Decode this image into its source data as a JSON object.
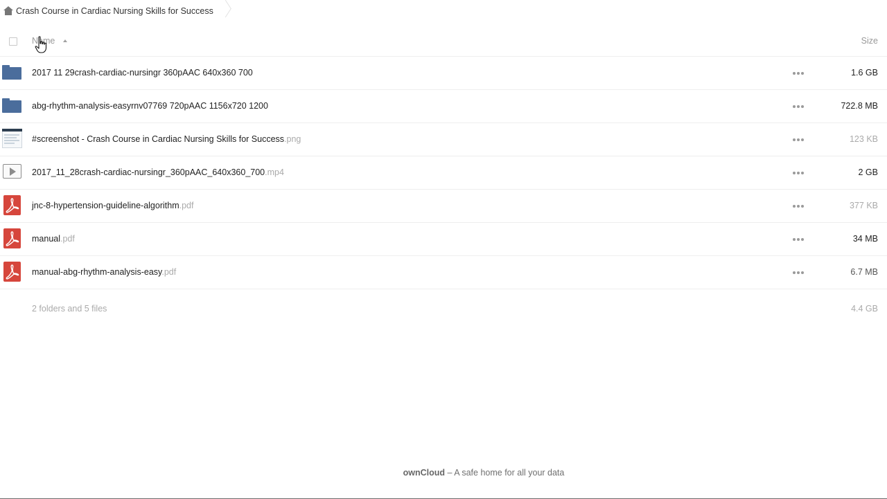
{
  "breadcrumb": {
    "home_icon": "home-icon",
    "current": "Crash Course in Cardiac Nursing Skills for Success"
  },
  "header": {
    "name_label": "Name",
    "size_label": "Size",
    "sort_icon": "sort-ascending-icon"
  },
  "files": [
    {
      "type": "folder",
      "icon": "folder-icon",
      "name": "2017 11 29crash-cardiac-nursingr 360pAAC 640x360 700",
      "ext": "",
      "size": "1.6 GB",
      "size_tone": "dark"
    },
    {
      "type": "folder",
      "icon": "folder-icon",
      "name": "abg-rhythm-analysis-easyrnv07769 720pAAC 1156x720 1200",
      "ext": "",
      "size": "722.8 MB",
      "size_tone": "dark"
    },
    {
      "type": "image",
      "icon": "image-icon",
      "name": "#screenshot - Crash Course in Cardiac Nursing Skills for Success",
      "ext": ".png",
      "size": "123 KB",
      "size_tone": "light"
    },
    {
      "type": "video",
      "icon": "video-icon",
      "name": "2017_11_28crash-cardiac-nursingr_360pAAC_640x360_700",
      "ext": ".mp4",
      "size": "2 GB",
      "size_tone": "dark"
    },
    {
      "type": "pdf",
      "icon": "pdf-icon",
      "name": "jnc-8-hypertension-guideline-algorithm",
      "ext": ".pdf",
      "size": "377 KB",
      "size_tone": "light"
    },
    {
      "type": "pdf",
      "icon": "pdf-icon",
      "name": "manual",
      "ext": ".pdf",
      "size": "34 MB",
      "size_tone": "dark"
    },
    {
      "type": "pdf",
      "icon": "pdf-icon",
      "name": "manual-abg-rhythm-analysis-easy",
      "ext": ".pdf",
      "size": "6.7 MB",
      "size_tone": "mid"
    }
  ],
  "summary": {
    "count": "2 folders and 5 files",
    "total": "4.4 GB"
  },
  "footer": {
    "brand": "ownCloud",
    "tagline": " – A safe home for all your data"
  },
  "colors": {
    "folder": "#4b6d9c",
    "pdf": "#d6463c"
  }
}
